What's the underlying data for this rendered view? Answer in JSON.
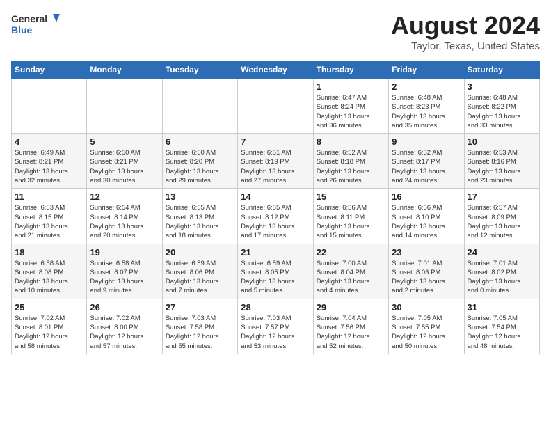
{
  "logo": {
    "line1": "General",
    "line2": "Blue"
  },
  "title": "August 2024",
  "subtitle": "Taylor, Texas, United States",
  "weekdays": [
    "Sunday",
    "Monday",
    "Tuesday",
    "Wednesday",
    "Thursday",
    "Friday",
    "Saturday"
  ],
  "weeks": [
    [
      {
        "day": "",
        "info": ""
      },
      {
        "day": "",
        "info": ""
      },
      {
        "day": "",
        "info": ""
      },
      {
        "day": "",
        "info": ""
      },
      {
        "day": "1",
        "info": "Sunrise: 6:47 AM\nSunset: 8:24 PM\nDaylight: 13 hours\nand 36 minutes."
      },
      {
        "day": "2",
        "info": "Sunrise: 6:48 AM\nSunset: 8:23 PM\nDaylight: 13 hours\nand 35 minutes."
      },
      {
        "day": "3",
        "info": "Sunrise: 6:48 AM\nSunset: 8:22 PM\nDaylight: 13 hours\nand 33 minutes."
      }
    ],
    [
      {
        "day": "4",
        "info": "Sunrise: 6:49 AM\nSunset: 8:21 PM\nDaylight: 13 hours\nand 32 minutes."
      },
      {
        "day": "5",
        "info": "Sunrise: 6:50 AM\nSunset: 8:21 PM\nDaylight: 13 hours\nand 30 minutes."
      },
      {
        "day": "6",
        "info": "Sunrise: 6:50 AM\nSunset: 8:20 PM\nDaylight: 13 hours\nand 29 minutes."
      },
      {
        "day": "7",
        "info": "Sunrise: 6:51 AM\nSunset: 8:19 PM\nDaylight: 13 hours\nand 27 minutes."
      },
      {
        "day": "8",
        "info": "Sunrise: 6:52 AM\nSunset: 8:18 PM\nDaylight: 13 hours\nand 26 minutes."
      },
      {
        "day": "9",
        "info": "Sunrise: 6:52 AM\nSunset: 8:17 PM\nDaylight: 13 hours\nand 24 minutes."
      },
      {
        "day": "10",
        "info": "Sunrise: 6:53 AM\nSunset: 8:16 PM\nDaylight: 13 hours\nand 23 minutes."
      }
    ],
    [
      {
        "day": "11",
        "info": "Sunrise: 6:53 AM\nSunset: 8:15 PM\nDaylight: 13 hours\nand 21 minutes."
      },
      {
        "day": "12",
        "info": "Sunrise: 6:54 AM\nSunset: 8:14 PM\nDaylight: 13 hours\nand 20 minutes."
      },
      {
        "day": "13",
        "info": "Sunrise: 6:55 AM\nSunset: 8:13 PM\nDaylight: 13 hours\nand 18 minutes."
      },
      {
        "day": "14",
        "info": "Sunrise: 6:55 AM\nSunset: 8:12 PM\nDaylight: 13 hours\nand 17 minutes."
      },
      {
        "day": "15",
        "info": "Sunrise: 6:56 AM\nSunset: 8:11 PM\nDaylight: 13 hours\nand 15 minutes."
      },
      {
        "day": "16",
        "info": "Sunrise: 6:56 AM\nSunset: 8:10 PM\nDaylight: 13 hours\nand 14 minutes."
      },
      {
        "day": "17",
        "info": "Sunrise: 6:57 AM\nSunset: 8:09 PM\nDaylight: 13 hours\nand 12 minutes."
      }
    ],
    [
      {
        "day": "18",
        "info": "Sunrise: 6:58 AM\nSunset: 8:08 PM\nDaylight: 13 hours\nand 10 minutes."
      },
      {
        "day": "19",
        "info": "Sunrise: 6:58 AM\nSunset: 8:07 PM\nDaylight: 13 hours\nand 9 minutes."
      },
      {
        "day": "20",
        "info": "Sunrise: 6:59 AM\nSunset: 8:06 PM\nDaylight: 13 hours\nand 7 minutes."
      },
      {
        "day": "21",
        "info": "Sunrise: 6:59 AM\nSunset: 8:05 PM\nDaylight: 13 hours\nand 5 minutes."
      },
      {
        "day": "22",
        "info": "Sunrise: 7:00 AM\nSunset: 8:04 PM\nDaylight: 13 hours\nand 4 minutes."
      },
      {
        "day": "23",
        "info": "Sunrise: 7:01 AM\nSunset: 8:03 PM\nDaylight: 13 hours\nand 2 minutes."
      },
      {
        "day": "24",
        "info": "Sunrise: 7:01 AM\nSunset: 8:02 PM\nDaylight: 13 hours\nand 0 minutes."
      }
    ],
    [
      {
        "day": "25",
        "info": "Sunrise: 7:02 AM\nSunset: 8:01 PM\nDaylight: 12 hours\nand 58 minutes."
      },
      {
        "day": "26",
        "info": "Sunrise: 7:02 AM\nSunset: 8:00 PM\nDaylight: 12 hours\nand 57 minutes."
      },
      {
        "day": "27",
        "info": "Sunrise: 7:03 AM\nSunset: 7:58 PM\nDaylight: 12 hours\nand 55 minutes."
      },
      {
        "day": "28",
        "info": "Sunrise: 7:03 AM\nSunset: 7:57 PM\nDaylight: 12 hours\nand 53 minutes."
      },
      {
        "day": "29",
        "info": "Sunrise: 7:04 AM\nSunset: 7:56 PM\nDaylight: 12 hours\nand 52 minutes."
      },
      {
        "day": "30",
        "info": "Sunrise: 7:05 AM\nSunset: 7:55 PM\nDaylight: 12 hours\nand 50 minutes."
      },
      {
        "day": "31",
        "info": "Sunrise: 7:05 AM\nSunset: 7:54 PM\nDaylight: 12 hours\nand 48 minutes."
      }
    ]
  ]
}
